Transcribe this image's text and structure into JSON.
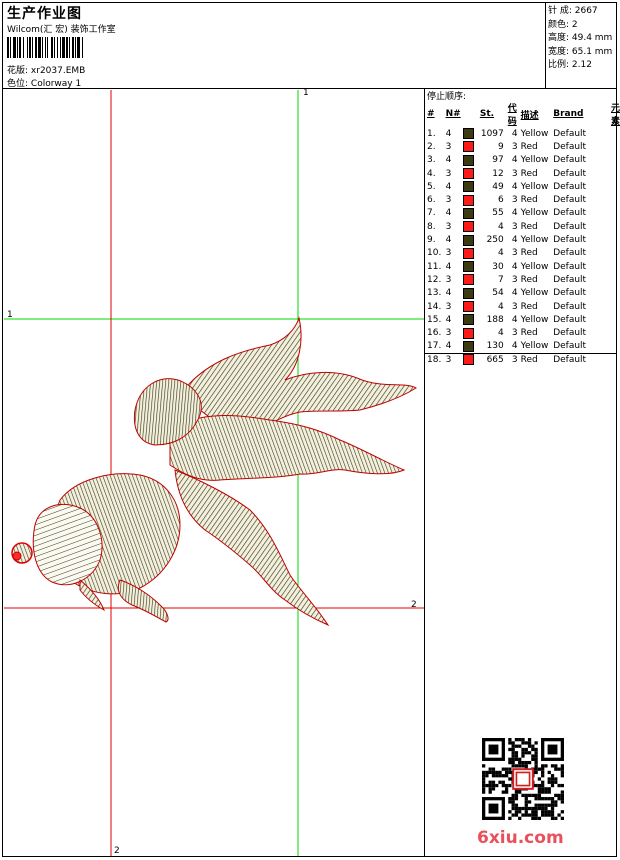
{
  "header": {
    "title": "生产作业图",
    "subtitle": "Wilcom(汇 宏) 装饰工作室",
    "design_label": "花版:",
    "design_value": "xr2037.EMB",
    "colorway_label": "色位:",
    "colorway_value": "Colorway 1"
  },
  "stats": {
    "stitches": "针 成: 2667",
    "colors": "颜色: 2",
    "height": "高度: 49.4 mm",
    "width": "宽度: 65.1 mm",
    "ratio": "比例: 2.12"
  },
  "stop_sequence": {
    "title": "停止顺序:",
    "headers": [
      "#",
      "N#",
      "St.",
      "代码",
      "描述",
      "Brand",
      "元素"
    ],
    "rows": [
      {
        "idx": "1.",
        "n": "4",
        "color": "#3b3a12",
        "st": "1097",
        "code": "4",
        "desc": "Yellow",
        "brand": "Default"
      },
      {
        "idx": "2.",
        "n": "3",
        "color": "#ff1a1a",
        "st": "9",
        "code": "3",
        "desc": "Red",
        "brand": "Default"
      },
      {
        "idx": "3.",
        "n": "4",
        "color": "#3b3a12",
        "st": "97",
        "code": "4",
        "desc": "Yellow",
        "brand": "Default"
      },
      {
        "idx": "4.",
        "n": "3",
        "color": "#ff1a1a",
        "st": "12",
        "code": "3",
        "desc": "Red",
        "brand": "Default"
      },
      {
        "idx": "5.",
        "n": "4",
        "color": "#3b3a12",
        "st": "49",
        "code": "4",
        "desc": "Yellow",
        "brand": "Default"
      },
      {
        "idx": "6.",
        "n": "3",
        "color": "#ff1a1a",
        "st": "6",
        "code": "3",
        "desc": "Red",
        "brand": "Default"
      },
      {
        "idx": "7.",
        "n": "4",
        "color": "#3b3a12",
        "st": "55",
        "code": "4",
        "desc": "Yellow",
        "brand": "Default"
      },
      {
        "idx": "8.",
        "n": "3",
        "color": "#ff1a1a",
        "st": "4",
        "code": "3",
        "desc": "Red",
        "brand": "Default"
      },
      {
        "idx": "9.",
        "n": "4",
        "color": "#3b3a12",
        "st": "250",
        "code": "4",
        "desc": "Yellow",
        "brand": "Default"
      },
      {
        "idx": "10.",
        "n": "3",
        "color": "#ff1a1a",
        "st": "4",
        "code": "3",
        "desc": "Red",
        "brand": "Default"
      },
      {
        "idx": "11.",
        "n": "4",
        "color": "#3b3a12",
        "st": "30",
        "code": "4",
        "desc": "Yellow",
        "brand": "Default"
      },
      {
        "idx": "12.",
        "n": "3",
        "color": "#ff1a1a",
        "st": "7",
        "code": "3",
        "desc": "Red",
        "brand": "Default"
      },
      {
        "idx": "13.",
        "n": "4",
        "color": "#3b3a12",
        "st": "54",
        "code": "4",
        "desc": "Yellow",
        "brand": "Default"
      },
      {
        "idx": "14.",
        "n": "3",
        "color": "#ff1a1a",
        "st": "4",
        "code": "3",
        "desc": "Red",
        "brand": "Default"
      },
      {
        "idx": "15.",
        "n": "4",
        "color": "#3b3a12",
        "st": "188",
        "code": "4",
        "desc": "Yellow",
        "brand": "Default"
      },
      {
        "idx": "16.",
        "n": "3",
        "color": "#ff1a1a",
        "st": "4",
        "code": "3",
        "desc": "Red",
        "brand": "Default"
      },
      {
        "idx": "17.",
        "n": "4",
        "color": "#3b3a12",
        "st": "130",
        "code": "4",
        "desc": "Yellow",
        "brand": "Default"
      },
      {
        "idx": "18.",
        "n": "3",
        "color": "#ff1a1a",
        "st": "665",
        "code": "3",
        "desc": "Red",
        "brand": "Default"
      }
    ]
  },
  "guides": {
    "label_1": "1",
    "label_2": "2",
    "green_color": "#00d800",
    "red_color": "#e00000"
  },
  "watermark": {
    "site": "6xiu.com"
  }
}
